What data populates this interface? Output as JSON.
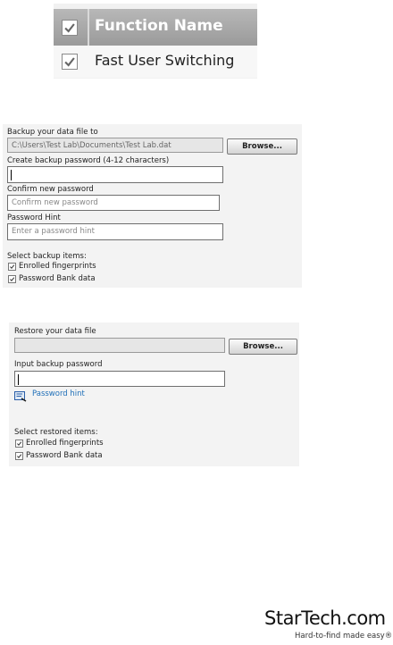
{
  "function_table": {
    "header": "Function Name",
    "row_label": "Fast User Switching"
  },
  "backup": {
    "file_label": "Backup your data file to",
    "file_path": "C:\\Users\\Test Lab\\Documents\\Test Lab.dat",
    "browse_label": "Browse...",
    "password_label": "Create backup password (4-12 characters)",
    "password_value": "",
    "confirm_label": "Confirm new password",
    "confirm_placeholder": "Confirm new password",
    "hint_label": "Password Hint",
    "hint_placeholder": "Enter a password hint",
    "items_label": "Select backup items:",
    "items": [
      "Enrolled fingerprints",
      "Password Bank data"
    ]
  },
  "restore": {
    "file_label": "Restore your data file",
    "file_path": "",
    "browse_label": "Browse...",
    "password_label": "Input backup password",
    "password_value": "",
    "hint_link": "Password hint",
    "items_label": "Select restored items:",
    "items": [
      "Enrolled fingerprints",
      "Password Bank data"
    ]
  },
  "logo": {
    "wordmark": "StarTech.com",
    "tagline": "Hard-to-find made easy®"
  },
  "colors": {
    "header_bg": "#a8a8a8",
    "panel_bg": "#f3f3f3",
    "link": "#1f6fb8",
    "button_border": "#7a7a7a"
  }
}
